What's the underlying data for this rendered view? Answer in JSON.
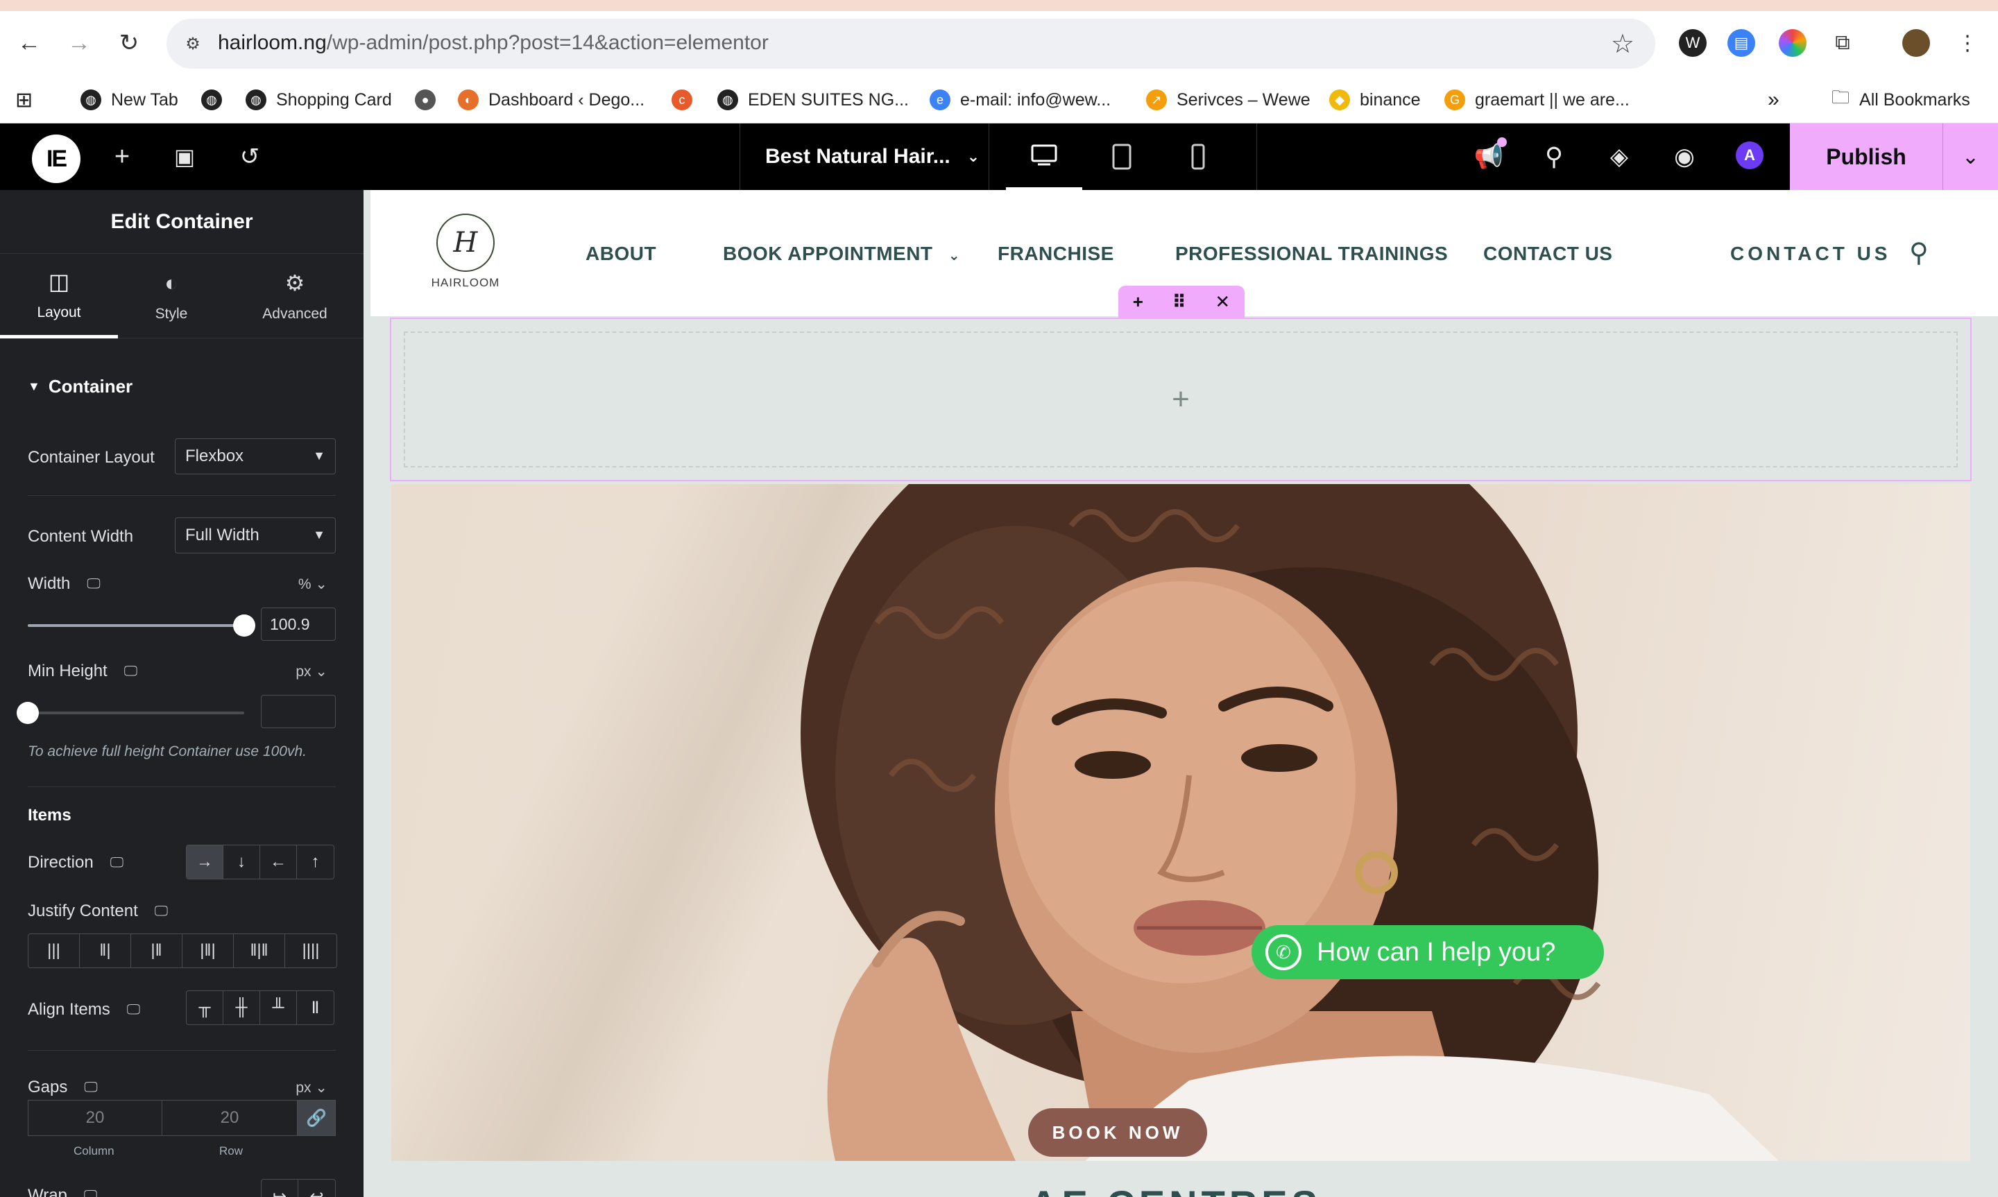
{
  "browser": {
    "url_host": "hairloom.ng",
    "url_path": "/wp-admin/post.php?post=14&action=elementor",
    "bookmarks": [
      {
        "label": "New Tab",
        "color": "#222222"
      },
      {
        "label": "",
        "color": "#222222"
      },
      {
        "label": "Shopping Card",
        "color": "#222222"
      },
      {
        "label": "",
        "color": "#555555"
      },
      {
        "label": "Dashboard ‹ Dego...",
        "color": "#e76f2a"
      },
      {
        "label": "",
        "color": "#e8592c"
      },
      {
        "label": "EDEN SUITES NG...",
        "color": "#222222"
      },
      {
        "label": "e-mail: info@wew...",
        "color": "#3b82f6"
      },
      {
        "label": "Serivces – Wewe",
        "color": "#f59e0b"
      },
      {
        "label": "binance",
        "color": "#f0b90b"
      },
      {
        "label": "graemart || we are...",
        "color": "#f59e0b"
      }
    ],
    "all_bookmarks": "All Bookmarks",
    "more_bookmarks": "»"
  },
  "editor": {
    "page_title": "Best Natural Hair...",
    "publish": "Publish"
  },
  "panel": {
    "title": "Edit Container",
    "tabs": [
      {
        "label": "Layout"
      },
      {
        "label": "Style"
      },
      {
        "label": "Advanced"
      }
    ],
    "section": "Container",
    "container_layout": {
      "label": "Container Layout",
      "value": "Flexbox"
    },
    "content_width": {
      "label": "Content Width",
      "value": "Full Width"
    },
    "width": {
      "label": "Width",
      "unit": "%",
      "value": "100.9",
      "percent": 100
    },
    "min_height": {
      "label": "Min Height",
      "unit": "px",
      "value": "",
      "percent": 0
    },
    "hint": "To achieve full height Container use 100vh.",
    "items_heading": "Items",
    "direction": {
      "label": "Direction"
    },
    "justify": {
      "label": "Justify Content"
    },
    "align": {
      "label": "Align Items"
    },
    "gaps": {
      "label": "Gaps",
      "unit": "px",
      "column": "20",
      "row": "20",
      "column_caption": "Column",
      "row_caption": "Row"
    },
    "wrap": {
      "label": "Wrap"
    }
  },
  "site": {
    "logo_text": "HAIRLOOM",
    "logo_mark": "H",
    "menu": [
      "ABOUT",
      "BOOK APPOINTMENT",
      "FRANCHISE",
      "PROFESSIONAL TRAININGS",
      "CONTACT US"
    ],
    "menu_contact_button": "CONTACT US",
    "book_now": "BOOK NOW",
    "whatsapp": "How can I help you?",
    "below_heading": "AE CENTRES"
  },
  "colors": {
    "publish_bg": "#f0abfc",
    "panel_bg": "#1f2124",
    "canvas_bg": "#dfe6e4",
    "menu_text": "#2f4f4f",
    "book_now_bg": "#8b5a4f",
    "whatsapp_bg": "#34c759"
  }
}
